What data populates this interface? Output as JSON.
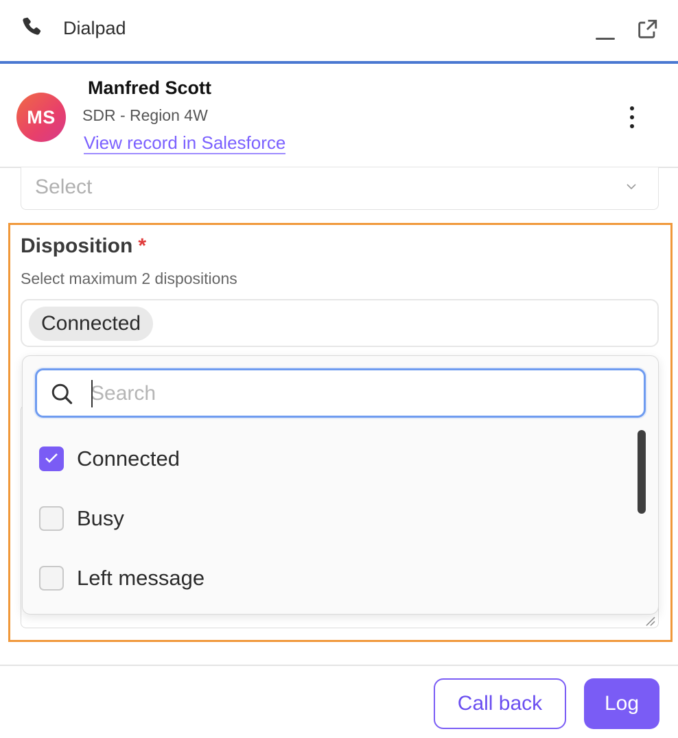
{
  "header": {
    "title": "Dialpad",
    "phone_icon": "phone-icon",
    "minimize_icon": "minimize-icon",
    "popout_icon": "external-link-icon"
  },
  "contact": {
    "initials": "MS",
    "name": "Manfred Scott",
    "role": "SDR - Region 4W",
    "link_text": "View record in Salesforce"
  },
  "select": {
    "placeholder": "Select"
  },
  "disposition": {
    "label": "Disposition",
    "required_mark": "*",
    "help": "Select maximum 2 dispositions",
    "selected_chips": [
      "Connected"
    ],
    "search_placeholder": "Search",
    "options": [
      {
        "label": "Connected",
        "checked": true
      },
      {
        "label": "Busy",
        "checked": false
      },
      {
        "label": "Left message",
        "checked": false
      }
    ]
  },
  "footer": {
    "callback_label": "Call back",
    "log_label": "Log"
  },
  "colors": {
    "accent": "#7a5cf5",
    "header_line": "#4a78d1",
    "highlight_frame": "#f0983a",
    "required": "#e03c3c"
  }
}
